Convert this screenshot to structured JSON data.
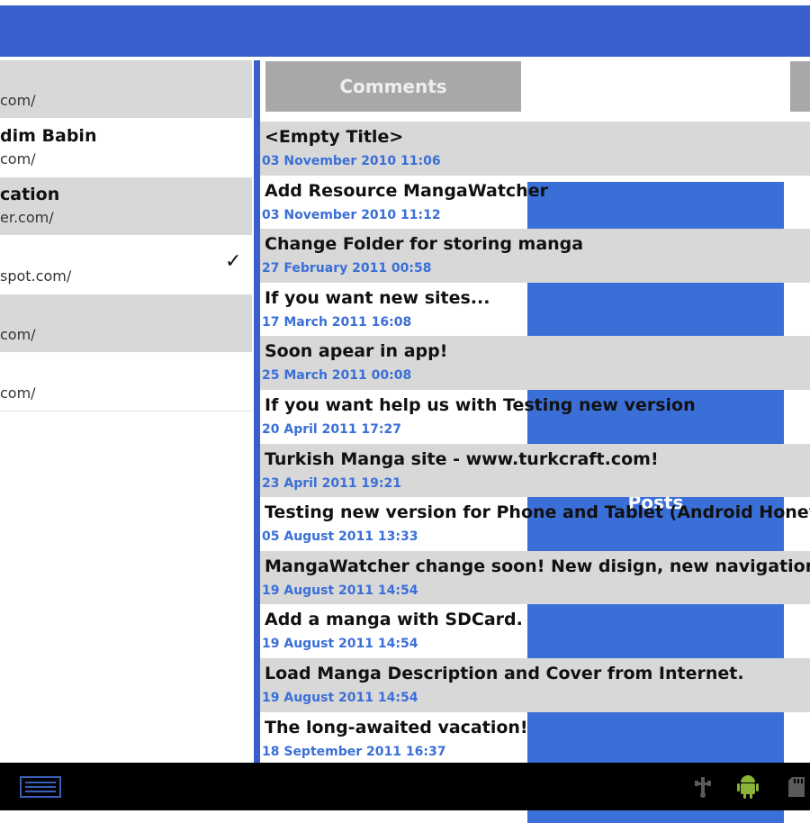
{
  "colors": {
    "accent": "#3a5fcd",
    "tab_active": "#3a6fd8",
    "tab_inactive": "#a8a8a8",
    "row_alt": "#d8d8d8",
    "date": "#3a6fd8"
  },
  "left_list": [
    {
      "title": "",
      "url": "com/",
      "checked": false
    },
    {
      "title": "dim Babin",
      "url": "com/",
      "checked": false
    },
    {
      "title": "cation",
      "url": "er.com/",
      "checked": false
    },
    {
      "title": "",
      "url": "spot.com/",
      "checked": true
    },
    {
      "title": "",
      "url": "com/",
      "checked": false
    },
    {
      "title": "",
      "url": "com/",
      "checked": false
    }
  ],
  "tabs": [
    {
      "label": "Comments",
      "active": false
    },
    {
      "label": "Posts",
      "active": true
    },
    {
      "label": "",
      "active": false
    }
  ],
  "posts": [
    {
      "title": "<Empty Title>",
      "date": "03 November 2010 11:06"
    },
    {
      "title": "Add Resource MangaWatcher",
      "date": "03 November 2010 11:12"
    },
    {
      "title": "Change Folder for storing manga",
      "date": "27 February 2011 00:58"
    },
    {
      "title": "If you want new sites...",
      "date": "17 March 2011 16:08"
    },
    {
      "title": "Soon apear in app!",
      "date": "25 March 2011 00:08"
    },
    {
      "title": "If you want help us with Testing new version",
      "date": "20 April 2011 17:27"
    },
    {
      "title": "Turkish Manga site - www.turkcraft.com!",
      "date": "23 April 2011 19:21"
    },
    {
      "title": "Testing new version for Phone and Tablet (Android Honeycomb",
      "date": "05 August 2011 13:33"
    },
    {
      "title": "MangaWatcher change soon! New disign, new navigation...",
      "date": "19 August 2011 14:54"
    },
    {
      "title": "Add a manga with SDCard.",
      "date": "19 August 2011 14:54"
    },
    {
      "title": "Load Manga Description and Cover from Internet.",
      "date": "19 August 2011 14:54"
    },
    {
      "title": "The long-awaited vacation!",
      "date": "18 September 2011 16:37"
    }
  ],
  "navbar": {
    "icons": [
      "keyboard-icon",
      "usb-icon",
      "android-debug-icon",
      "sd-card-icon"
    ]
  }
}
